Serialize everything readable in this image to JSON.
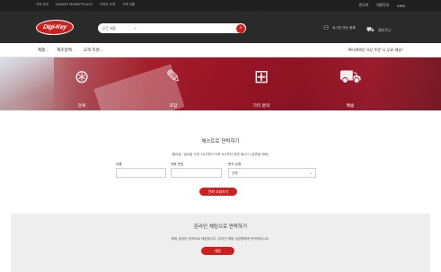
{
  "top_strip": {
    "left_links": [
      "구독 관리",
      "DIGIKEY MARKETPLACE",
      "디지키 소개",
      "고객 지원"
    ],
    "right_links": [
      "한국어",
      "대한민국",
      "KRW"
    ]
  },
  "header": {
    "logo_text": "Digi-Key",
    "search": {
      "category_label": "모든 제품",
      "placeholder": "",
      "button_icon": "search-icon"
    },
    "account_label": "로그인 또는 등록",
    "cart_label": "장바구니"
  },
  "subnav": {
    "items": [
      "제품",
      "제조업체",
      "고객 지원"
    ],
    "notice": "99,000원 이상 주문 시 무료 배송!"
  },
  "hero": {
    "items": [
      {
        "label": "관세",
        "icon": "customs-icon"
      },
      {
        "label": "포장",
        "icon": "package-icon"
      },
      {
        "label": "기타 문의",
        "icon": "box-question-icon"
      },
      {
        "label": "배송",
        "icon": "delivery-truck-icon"
      }
    ]
  },
  "contact_section": {
    "title": "체스트로 연락하기",
    "description": "월요일~금요일 오전 10시부터 오후 6시까지 운영 됩니다 (공휴일 제외)",
    "fields": [
      {
        "label": "이름",
        "value": ""
      },
      {
        "label": "전화 번호",
        "value": ""
      },
      {
        "label": "문의 유형",
        "value": "선택"
      }
    ],
    "button_label": "전화 요청하기"
  },
  "chat_section": {
    "title": "온라인 채팅으로 연락하기",
    "description": "채팅 상담은 한국어로 제공됩니다. 온라인 채팅 상담원에게 문의하십시오.",
    "button_label": "채팅"
  },
  "colors": {
    "brand_red": "#cc1f1f",
    "header_dark": "#2a2a2a",
    "topbar": "#1f1f1f",
    "hero_red": "#9b1526"
  }
}
